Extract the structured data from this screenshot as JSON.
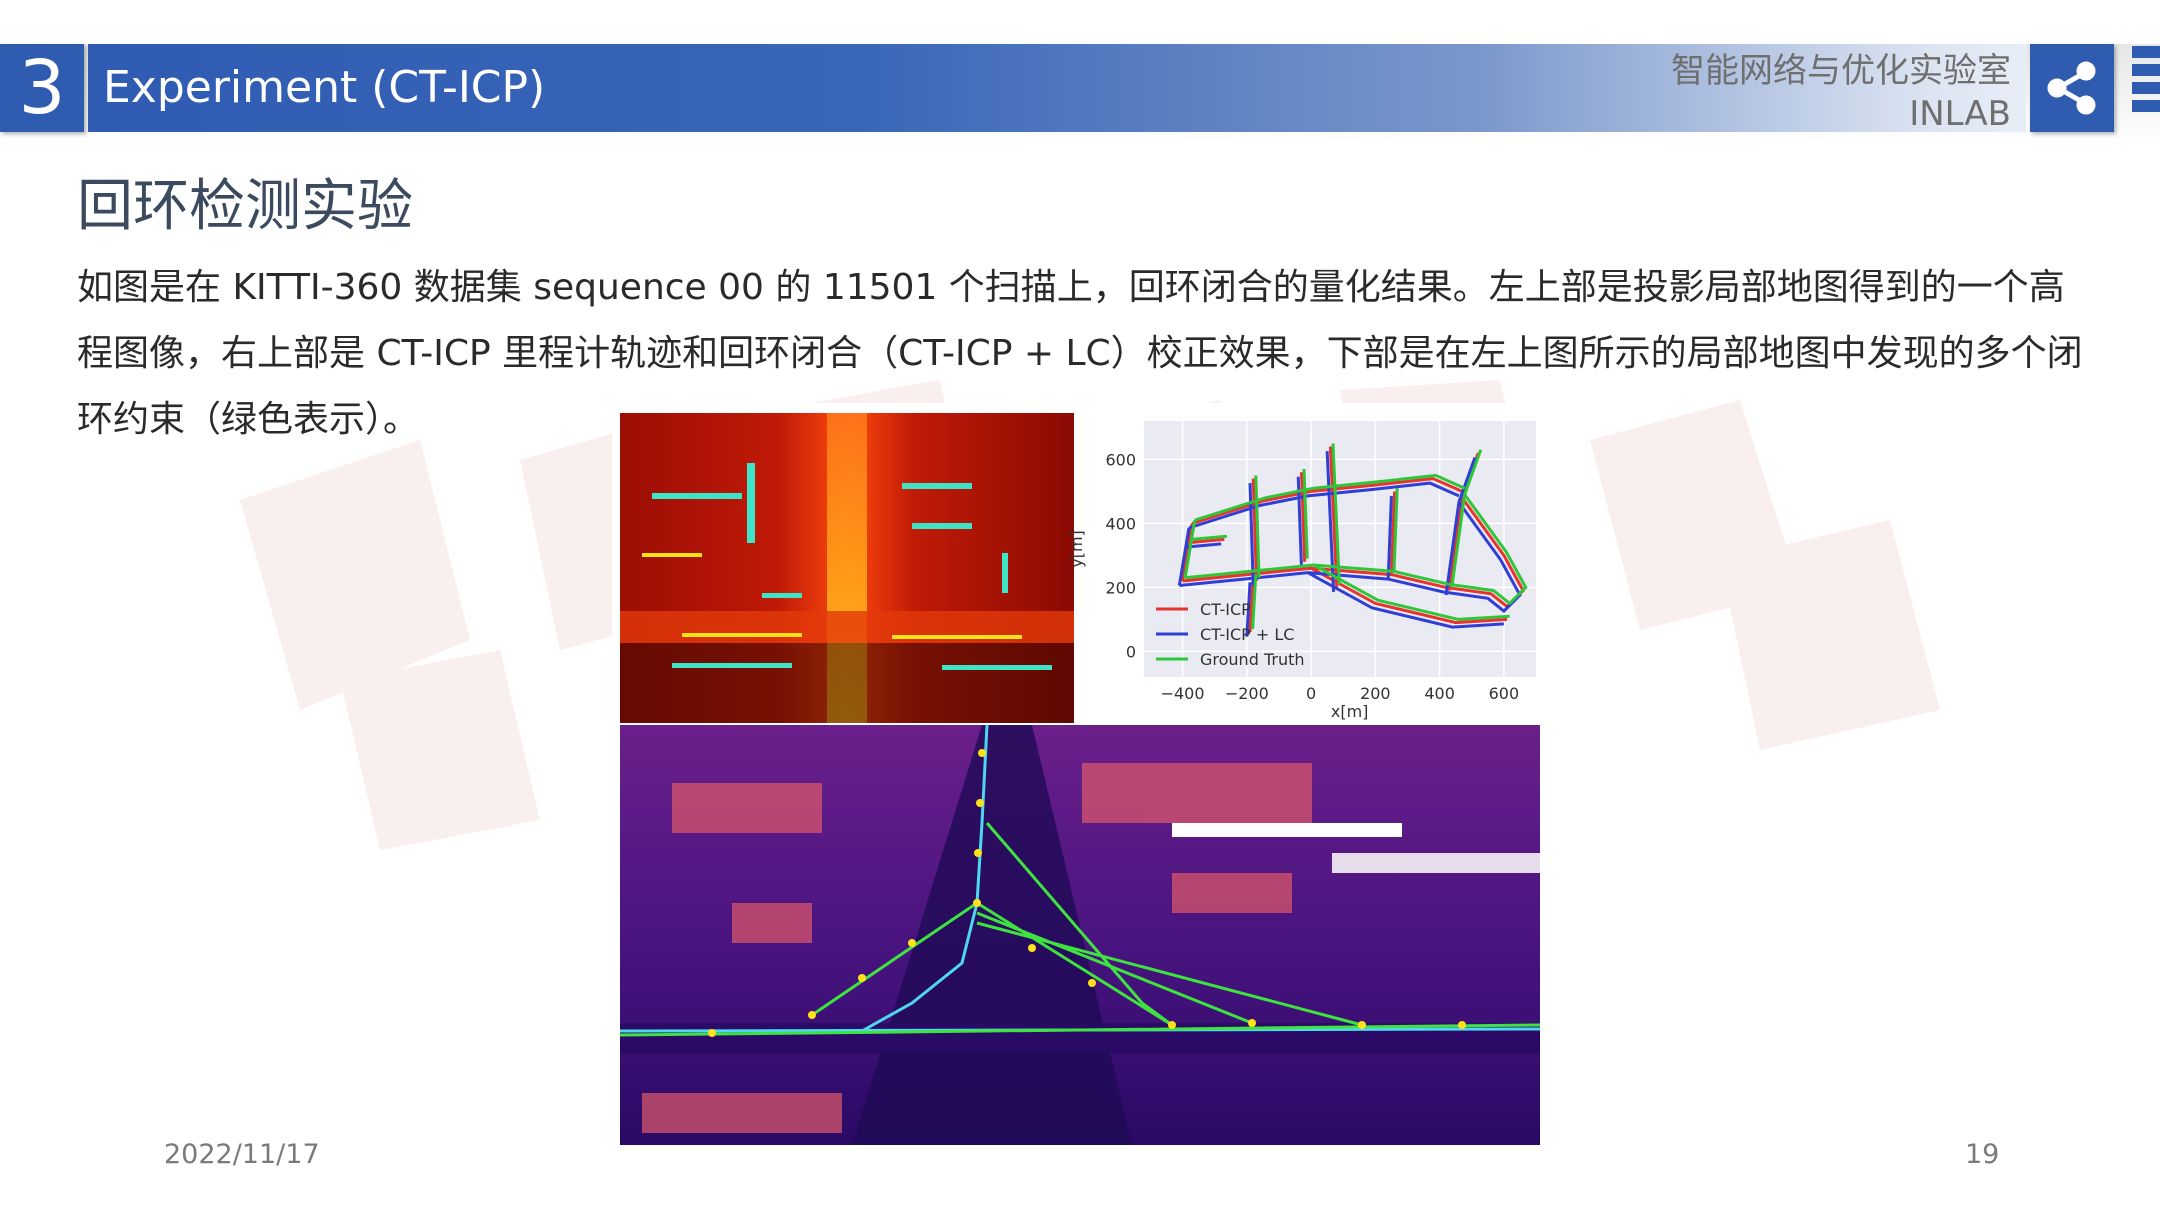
{
  "header": {
    "section_number": "3",
    "title": "Experiment (CT-ICP)",
    "lab_name_cn": "智能网络与优化实验室",
    "lab_name_en": "INLAB",
    "accent_color": "#2f5bb0"
  },
  "section_title": "回环检测实验",
  "body_text": "如图是在 KITTI-360 数据集 sequence 00 的 11501 个扫描上，回环闭合的量化结果。左上部是投影局部地图得到的一个高程图像，右上部是 CT-ICP 里程计轨迹和回环闭合（CT-ICP + LC）校正效果，下部是在左上图所示的局部地图中发现的多个闭环约束（绿色表示）。",
  "figure": {
    "chart_data": {
      "type": "line",
      "xlabel": "x[m]",
      "ylabel": "y[m]",
      "xlim": [
        -520,
        700
      ],
      "ylim": [
        -80,
        720
      ],
      "xticks": [
        "−400",
        "−200",
        "0",
        "200",
        "400",
        "600"
      ],
      "yticks": [
        "0",
        "200",
        "400",
        "600"
      ],
      "grid": true,
      "legend_position": "bottom-left",
      "series": [
        {
          "name": "CT-ICP",
          "color": "#e8332f"
        },
        {
          "name": "CT-ICP + LC",
          "color": "#2f3fd6"
        },
        {
          "name": "Ground Truth",
          "color": "#2fc63a"
        }
      ]
    }
  },
  "footer": {
    "date": "2022/11/17",
    "page_number": "19"
  },
  "icons": [
    "share-icon"
  ]
}
